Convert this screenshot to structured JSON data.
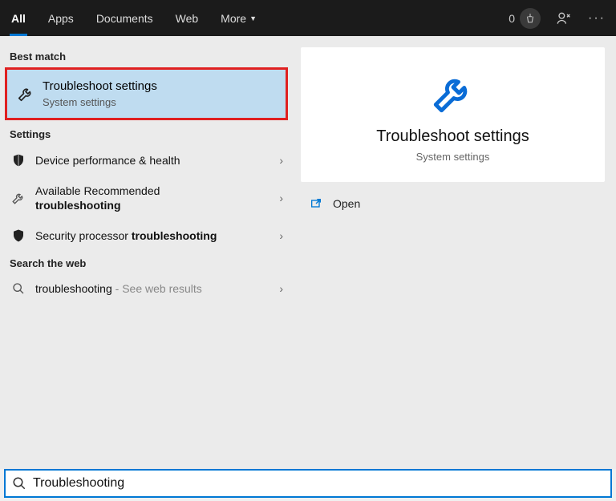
{
  "topbar": {
    "tabs": {
      "all": "All",
      "apps": "Apps",
      "documents": "Documents",
      "web": "Web",
      "more": "More"
    },
    "points": "0"
  },
  "sections": {
    "best_match": "Best match",
    "settings": "Settings",
    "search_web": "Search the web"
  },
  "best": {
    "title": "Troubleshoot settings",
    "subtitle": "System settings"
  },
  "settings_items": {
    "i0": {
      "title": "Device performance & health"
    },
    "i1": {
      "title_prefix": "Available Recommended ",
      "title_bold": "troubleshooting"
    },
    "i2": {
      "title_prefix": "Security processor ",
      "title_bold": "troubleshooting"
    }
  },
  "web_item": {
    "term": "troubleshooting",
    "suffix": " - See web results"
  },
  "detail": {
    "title": "Troubleshoot settings",
    "subtitle": "System settings",
    "open": "Open"
  },
  "search": {
    "value": "Troubleshooting"
  }
}
